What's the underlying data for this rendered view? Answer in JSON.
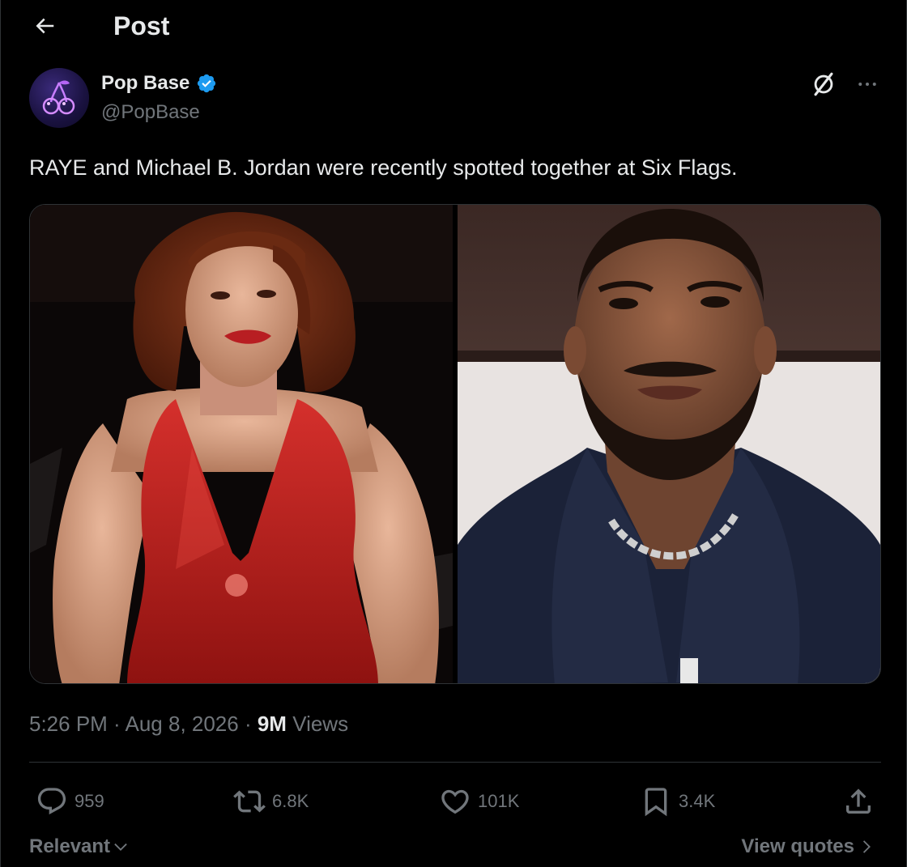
{
  "header": {
    "back_icon": "arrow-left-icon",
    "title": "Post"
  },
  "author": {
    "name": "Pop Base",
    "handle": "@PopBase",
    "verified_icon": "verified-badge-icon",
    "avatar_icon": "cherry-logo-icon"
  },
  "post": {
    "text": "RAYE and Michael B. Jordan were recently spotted together at Six Flags.",
    "timestamp": "5:26 PM · Aug 8, 2026 · ",
    "views_count": "9M",
    "views_label": " Views"
  },
  "actions": {
    "replies": "959",
    "reposts": "6.8K",
    "likes": "101K",
    "bookmarks": "3.4K"
  },
  "footer": {
    "sort_label": "Relevant",
    "quotes_label": "View quotes"
  },
  "colors": {
    "background": "#000000",
    "text_primary": "#e7e9ea",
    "text_secondary": "#71767b",
    "verified_blue": "#1d9bf0",
    "divider": "#2f3336"
  }
}
